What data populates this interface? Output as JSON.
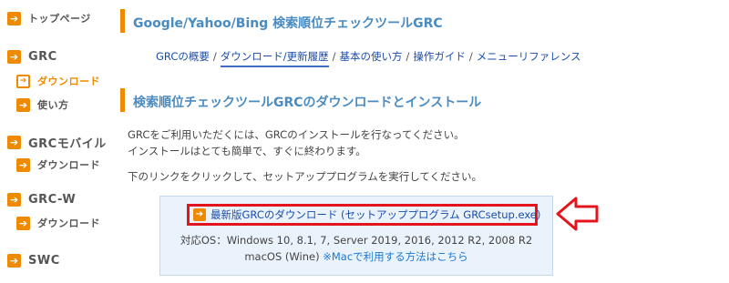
{
  "sidebar": {
    "items": [
      {
        "label": "トップページ"
      },
      {
        "label": "GRC"
      },
      {
        "label": "ダウンロード"
      },
      {
        "label": "使い方"
      },
      {
        "label": "GRCモバイル"
      },
      {
        "label": "ダウンロード"
      },
      {
        "label": "GRC-W"
      },
      {
        "label": "ダウンロード"
      },
      {
        "label": "SWC"
      }
    ]
  },
  "header": {
    "title": "Google/Yahoo/Bing 検索順位チェックツールGRC"
  },
  "nav": {
    "links": [
      "GRCの概要",
      "ダウンロード/更新履歴",
      "基本の使い方",
      "操作ガイド",
      "メニューリファレンス"
    ],
    "separator": "/"
  },
  "section": {
    "title": "検索順位チェックツールGRCのダウンロードとインストール"
  },
  "content": {
    "line1": "GRCをご利用いただくには、GRCのインストールを行なってください。",
    "line2": "インストールはとても簡単で、すぐに終わります。",
    "line3": "下のリンクをクリックして、セットアッププログラムを実行してください。"
  },
  "download": {
    "link_text": "最新版GRCのダウンロード (セットアッププログラム GRCsetup.exe)",
    "os_line1": "対応OS：Windows 10, 8.1, 7, Server 2019, 2016, 2012 R2, 2008 R2",
    "os_line2_prefix": "macOS (Wine) ",
    "mac_link": "※Macで利用する方法はこちら"
  },
  "colors": {
    "accent": "#ee8a00",
    "highlight": "#e4141e",
    "link": "#1a4dab",
    "heading": "#4a8bc0"
  },
  "icons": {
    "bullet": "arrow-right-icon",
    "callout": "left-arrow-outline-icon"
  }
}
